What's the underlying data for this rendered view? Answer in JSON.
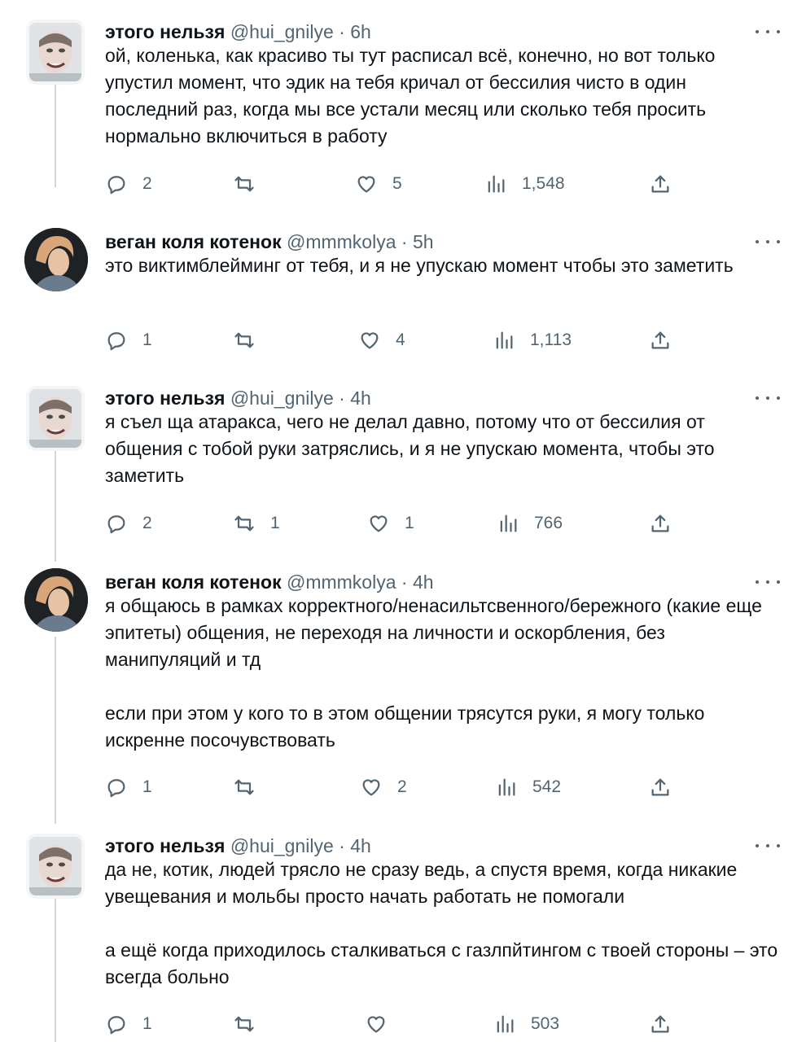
{
  "tweets": [
    {
      "name": "этого нельзя",
      "handle": "@hui_gnilye",
      "time": "6h",
      "avatar_icon": "avatar-photo",
      "paragraphs": [
        "ой, коленька, как красиво ты тут расписал всё, конечно, но вот только упустил момент, что эдик на тебя кричал от бессилия чисто в один последний раз, когда мы все устали месяц или сколько тебя просить нормально включиться в работу"
      ],
      "replies": "2",
      "retweets": "",
      "likes": "5",
      "views": "1,548"
    },
    {
      "name": "веган коля котенок",
      "handle": "@mmmkolya",
      "time": "5h",
      "avatar_icon": "avatar-photo",
      "paragraphs": [
        "это виктимблейминг от тебя, и я не упускаю момент чтобы это заметить"
      ],
      "replies": "1",
      "retweets": "",
      "likes": "4",
      "views": "1,113"
    },
    {
      "name": "этого нельзя",
      "handle": "@hui_gnilye",
      "time": "4h",
      "avatar_icon": "avatar-photo",
      "paragraphs": [
        "я съел ща атаракса, чего не делал давно, потому что от бессилия от общения с тобой руки затряслись, и я не упускаю момента, чтобы это заметить"
      ],
      "replies": "2",
      "retweets": "1",
      "likes": "1",
      "views": "766"
    },
    {
      "name": "веган коля котенок",
      "handle": "@mmmkolya",
      "time": "4h",
      "avatar_icon": "avatar-photo",
      "paragraphs": [
        "я общаюсь в рамках корректного/ненасильтсвенного/бережного (какие еще эпитеты) общения, не переходя на личности и оскорбления, без манипуляций и тд",
        "если при этом у кого то в этом общении трясутся руки, я могу только искренне посочувствовать"
      ],
      "replies": "1",
      "retweets": "",
      "likes": "2",
      "views": "542"
    },
    {
      "name": "этого нельзя",
      "handle": "@hui_gnilye",
      "time": "4h",
      "avatar_icon": "avatar-photo",
      "paragraphs": [
        "да не, котик, людей трясло не сразу ведь, а спустя время, когда никакие увещевания и мольбы просто начать работать не помогали",
        "а ещё когда приходилось сталкиваться с газлпйтингом с твоей стороны – это всегда больно"
      ],
      "replies": "1",
      "retweets": "",
      "likes": "",
      "views": "503"
    }
  ],
  "icons": {
    "reply": "reply-icon",
    "retweet": "retweet-icon",
    "like": "heart-icon",
    "views": "views-icon",
    "share": "share-icon",
    "more": "more-icon"
  },
  "separator": " · "
}
